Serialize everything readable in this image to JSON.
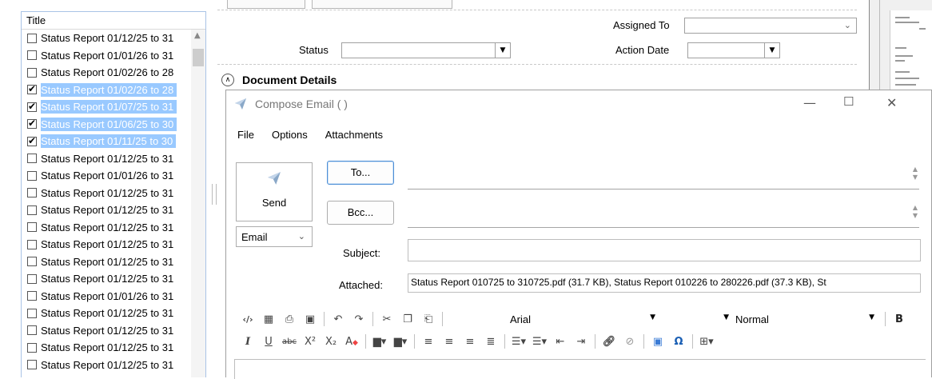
{
  "list": {
    "header": "Title",
    "rows": [
      {
        "label": "Status Report 01/12/25 to 31",
        "checked": false,
        "selected": false
      },
      {
        "label": "Status Report 01/01/26 to 31",
        "checked": false,
        "selected": false
      },
      {
        "label": "Status Report 01/02/26 to 28",
        "checked": false,
        "selected": false
      },
      {
        "label": "Status Report 01/02/26 to 28",
        "checked": true,
        "selected": true
      },
      {
        "label": "Status Report 01/07/25 to 31",
        "checked": true,
        "selected": true
      },
      {
        "label": "Status Report 01/06/25 to 30",
        "checked": true,
        "selected": true
      },
      {
        "label": "Status Report 01/11/25 to 30",
        "checked": true,
        "selected": true
      },
      {
        "label": "Status Report 01/12/25 to 31",
        "checked": false,
        "selected": false
      },
      {
        "label": "Status Report 01/01/26 to 31",
        "checked": false,
        "selected": false
      },
      {
        "label": "Status Report 01/12/25 to 31",
        "checked": false,
        "selected": false
      },
      {
        "label": "Status Report 01/12/25 to 31",
        "checked": false,
        "selected": false
      },
      {
        "label": "Status Report 01/12/25 to 31",
        "checked": false,
        "selected": false
      },
      {
        "label": "Status Report 01/12/25 to 31",
        "checked": false,
        "selected": false
      },
      {
        "label": "Status Report 01/12/25 to 31",
        "checked": false,
        "selected": false
      },
      {
        "label": "Status Report 01/12/25 to 31",
        "checked": false,
        "selected": false
      },
      {
        "label": "Status Report 01/01/26 to 31",
        "checked": false,
        "selected": false
      },
      {
        "label": "Status Report 01/12/25 to 31",
        "checked": false,
        "selected": false
      },
      {
        "label": "Status Report 01/12/25 to 31",
        "checked": false,
        "selected": false
      },
      {
        "label": "Status Report 01/12/25 to 31",
        "checked": false,
        "selected": false
      },
      {
        "label": "Status Report 01/12/25 to 31",
        "checked": false,
        "selected": false
      }
    ]
  },
  "form": {
    "assigned_to_label": "Assigned To",
    "assigned_to_value": "",
    "status_label": "Status",
    "status_value": "",
    "action_date_label": "Action Date",
    "action_date_value": "",
    "document_details_label": "Document Details"
  },
  "compose": {
    "title": "Compose Email ( )",
    "menu": [
      "File",
      "Options",
      "Attachments"
    ],
    "send_label": "Send",
    "send_mode": "Email",
    "to_label": "To...",
    "to_value": "",
    "bcc_label": "Bcc...",
    "bcc_value": "",
    "subject_label": "Subject:",
    "subject_value": "",
    "attached_label": "Attached:",
    "attached_value": "Status Report 010725 to 310725.pdf (31.7 KB), Status Report 010226 to 280226.pdf (37.3 KB), St",
    "font_name": "Arial",
    "font_size": "",
    "paragraph_style": "Normal"
  },
  "colors": {
    "selection": "#99c9ff",
    "focus_border": "#4d8fd6",
    "list_border": "#a9c3e6"
  }
}
